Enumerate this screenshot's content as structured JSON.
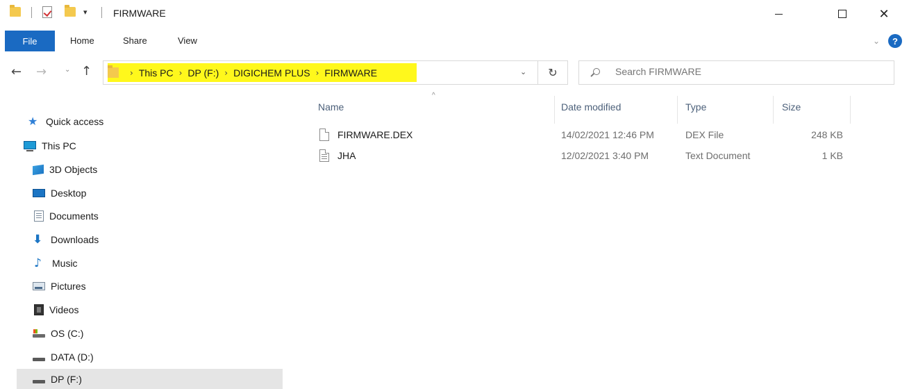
{
  "window": {
    "title": "FIRMWARE",
    "qa_dropdown_glyph": "▾",
    "minimize_icon": "minimize-icon",
    "maximize_icon": "maximize-icon",
    "close_glyph": "✕"
  },
  "ribbon": {
    "tabs": [
      "File",
      "Home",
      "Share",
      "View"
    ],
    "expand_glyph": "⌄",
    "help_glyph": "?"
  },
  "nav": {
    "back_glyph": "←",
    "forward_glyph": "→",
    "recent_glyph": "⌄",
    "up_glyph": "↑",
    "refresh_glyph": "↻",
    "address_dropdown_glyph": "⌄",
    "breadcrumb": [
      "This PC",
      "DP (F:)",
      "DIGICHEM PLUS",
      "FIRMWARE"
    ],
    "breadcrumb_sep": "›",
    "highlight_color": "#fff81c"
  },
  "search": {
    "placeholder": "Search FIRMWARE"
  },
  "sidebar": {
    "items": [
      {
        "label": "Quick access",
        "icon": "star-icon"
      },
      {
        "label": "This PC",
        "icon": "pc-icon"
      },
      {
        "label": "3D Objects",
        "icon": "3d-objects-icon"
      },
      {
        "label": "Desktop",
        "icon": "desktop-icon"
      },
      {
        "label": "Documents",
        "icon": "documents-icon"
      },
      {
        "label": "Downloads",
        "icon": "downloads-icon"
      },
      {
        "label": "Music",
        "icon": "music-icon"
      },
      {
        "label": "Pictures",
        "icon": "pictures-icon"
      },
      {
        "label": "Videos",
        "icon": "videos-icon"
      },
      {
        "label": "OS (C:)",
        "icon": "os-drive-icon"
      },
      {
        "label": "DATA (D:)",
        "icon": "drive-icon"
      },
      {
        "label": "DP (F:)",
        "icon": "drive-icon",
        "selected": true
      }
    ]
  },
  "files": {
    "columns": [
      "Name",
      "Date modified",
      "Type",
      "Size"
    ],
    "sort_glyph": "^",
    "rows": [
      {
        "name": "FIRMWARE.DEX",
        "date": "14/02/2021 12:46 PM",
        "type": "DEX File",
        "size": "248 KB",
        "icon": "file-icon"
      },
      {
        "name": "JHA",
        "date": "12/02/2021 3:40 PM",
        "type": "Text Document",
        "size": "1 KB",
        "icon": "text-file-icon"
      }
    ]
  },
  "colors": {
    "accent": "#1a6ac2",
    "selection": "#e5e5e5",
    "folder": "#f4c94e"
  }
}
